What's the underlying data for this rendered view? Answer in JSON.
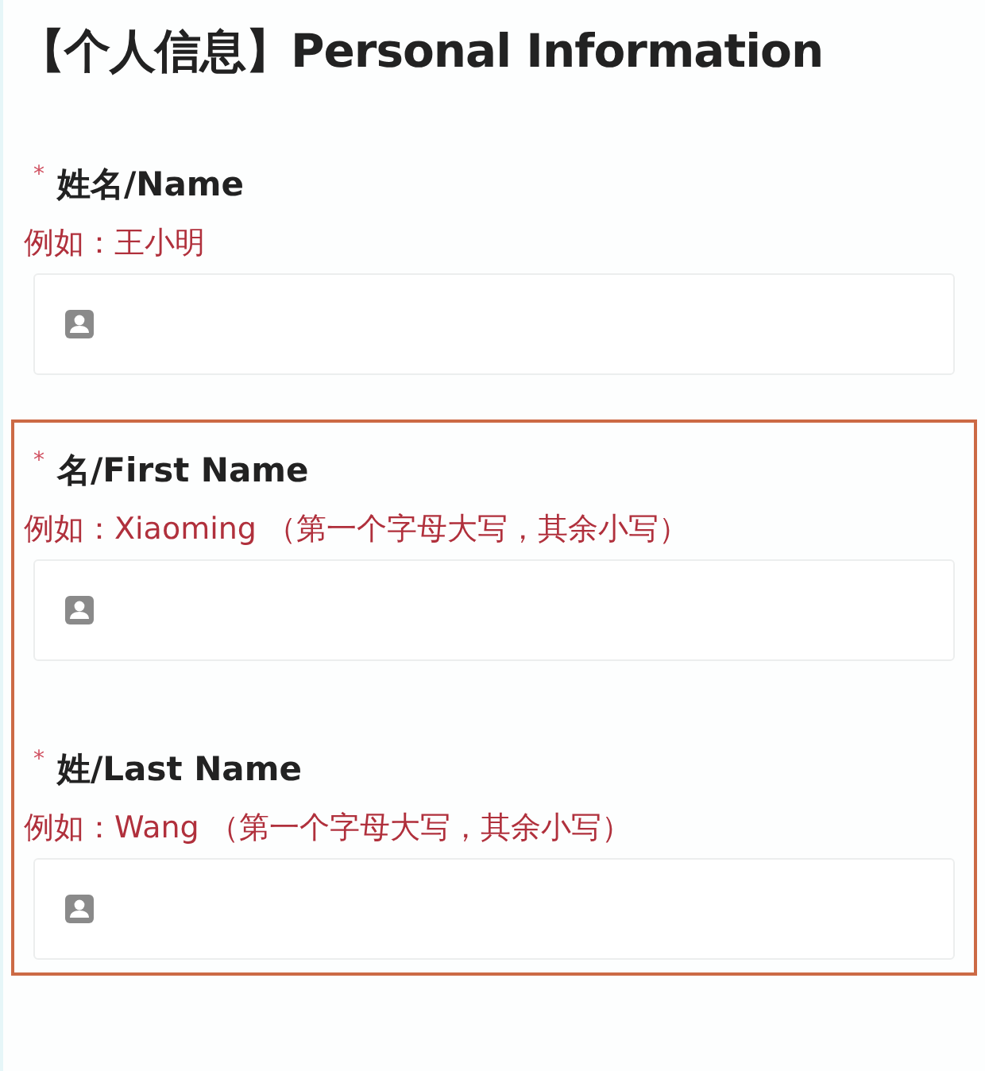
{
  "title": "【个人信息】Personal Information",
  "groups": [
    {
      "highlighted": false,
      "fields": [
        {
          "mark": "*",
          "label": "姓名/Name",
          "hint": "例如：王小明"
        }
      ]
    },
    {
      "highlighted": true,
      "fields": [
        {
          "mark": "*",
          "label": "名/First Name",
          "hint": "例如：Xiaoming （第一个字母大写，其余小写）"
        },
        {
          "mark": "*",
          "label": "姓/Last Name",
          "hint": "例如：Wang （第一个字母大写，其余小写）"
        }
      ]
    }
  ]
}
